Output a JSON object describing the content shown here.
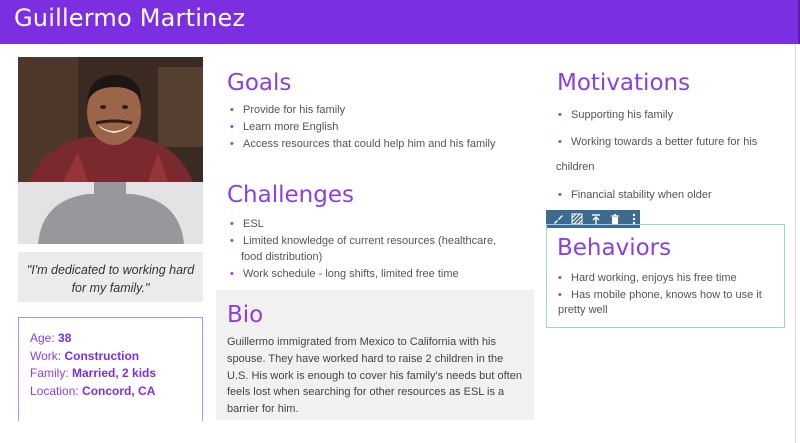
{
  "header": {
    "title": "Guillermo Martinez",
    "bg_color": "#7b2fe0"
  },
  "quote": "\"I'm dedicated to working hard for my family.\"",
  "facts": {
    "age_label": "Age:",
    "age_value": "38",
    "work_label": "Work:",
    "work_value": "Construction",
    "family_label": "Family:",
    "family_value": "Married, 2 kids",
    "location_label": "Location:",
    "location_value": "Concord, CA"
  },
  "goals": {
    "title": "Goals",
    "items": [
      "Provide for his family",
      "Learn more English",
      "Access resources that could help him and his family"
    ]
  },
  "challenges": {
    "title": "Challenges",
    "items": [
      "ESL",
      "Limited knowledge of current resources (healthcare,",
      "food distribution)",
      "Work schedule - long shifts, limited free time"
    ]
  },
  "bio": {
    "title": "Bio",
    "text": "Guillermo immigrated from Mexico to California with his spouse. They have worked hard to raise 2 children in the U.S. His work is enough to cover his family's needs but often feels lost when searching for other resources as ESL is a barrier for him."
  },
  "motivations": {
    "title": "Motivations",
    "items": [
      "Supporting his family",
      "Working towards a better future for his"
    ],
    "continuation": "children",
    "last_item": "Financial stability when older"
  },
  "behaviors": {
    "title": "Behaviors",
    "items": [
      "Hard working, enjoys his free time",
      "Has mobile phone, knows how to use it"
    ],
    "continuation": "pretty well"
  },
  "toolbar": {
    "icons": [
      "paint-brush-icon",
      "pattern-icon",
      "move-to-top-icon",
      "trash-icon",
      "more-vertical-icon"
    ],
    "bg_color": "#3d6b8f"
  },
  "colors": {
    "accent": "#8a3fe6",
    "border": "#9fcfe6"
  }
}
